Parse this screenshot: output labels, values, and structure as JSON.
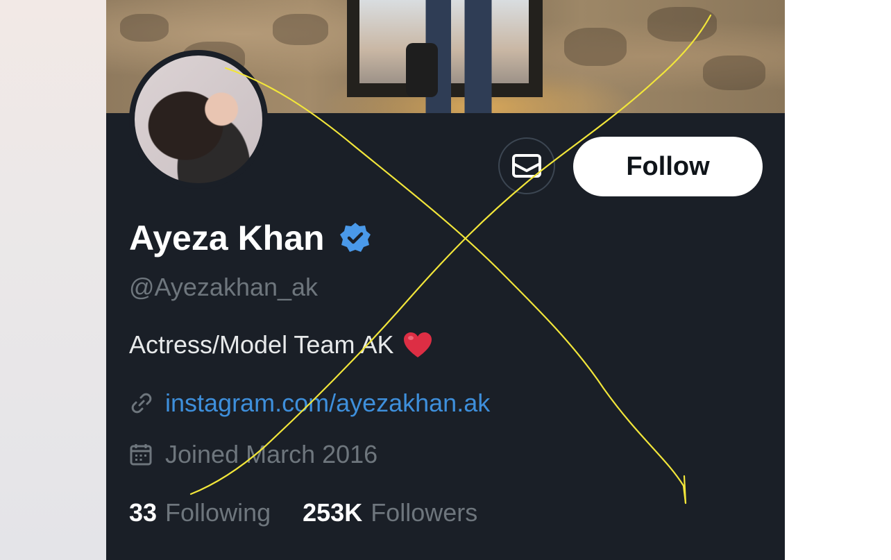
{
  "profile": {
    "display_name": "Ayeza Khan",
    "handle": "@Ayezakhan_ak",
    "bio": "Actress/Model Team AK",
    "website": "instagram.com/ayezakhan.ak",
    "joined": "Joined March 2016",
    "following_count": "33",
    "following_label": "Following",
    "followers_count": "253K",
    "followers_label": "Followers",
    "verified": true
  },
  "actions": {
    "follow_label": "Follow",
    "message_icon": "envelope-icon"
  },
  "icons": {
    "verified": "verified-badge-icon",
    "heart": "heart-emoji-icon",
    "link": "link-icon",
    "calendar": "calendar-icon"
  },
  "colors": {
    "card_background": "#1a1f27",
    "link": "#3e8fdb",
    "verified_badge": "#4a99e9",
    "muted_text": "#6e767d",
    "follow_button": "#ffffff",
    "annotation_stroke": "#f2e63a"
  }
}
